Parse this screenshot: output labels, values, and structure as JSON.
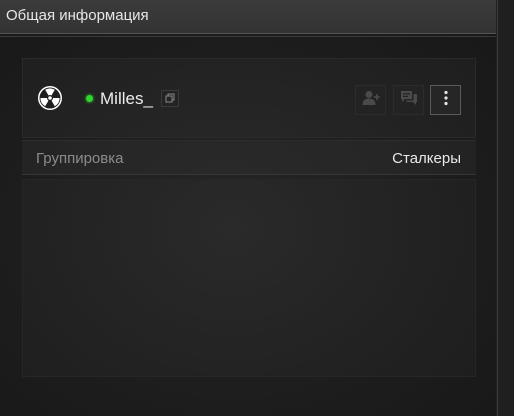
{
  "header": {
    "title": "Общая информация"
  },
  "profile": {
    "faction_icon": "radiation-icon",
    "status": "online",
    "status_color": "#2fd62f",
    "username": "Milles_"
  },
  "actions": {
    "copy_icon": "copy-icon",
    "add_friend_icon": "add-friend-icon",
    "message_icon": "chat-icon",
    "more_icon": "more-vertical-icon"
  },
  "info": {
    "group_label": "Группировка",
    "group_value": "Сталкеры"
  },
  "colors": {
    "background": "#1b1b1b",
    "header": "#363636",
    "accent_online": "#2fd62f"
  }
}
